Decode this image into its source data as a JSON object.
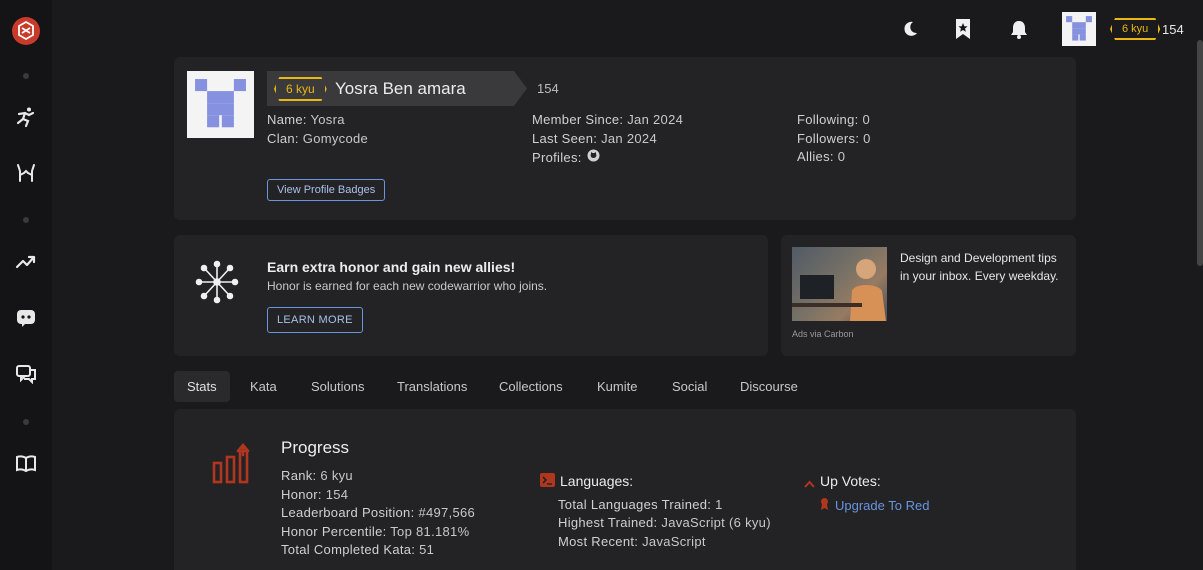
{
  "topbar": {
    "rank": "6 kyu",
    "honor": "154"
  },
  "profile": {
    "rank": "6 kyu",
    "username": "Yosra Ben amara",
    "honor": "154",
    "name_label": "Name:",
    "name": "Yosra",
    "clan_label": "Clan:",
    "clan": "Gomycode",
    "member_since_label": "Member Since:",
    "member_since": "Jan 2024",
    "last_seen_label": "Last Seen:",
    "last_seen": "Jan 2024",
    "profiles_label": "Profiles:",
    "following_label": "Following:",
    "following": "0",
    "followers_label": "Followers:",
    "followers": "0",
    "allies_label": "Allies:",
    "allies": "0",
    "badges_button": "View Profile Badges"
  },
  "promo": {
    "title": "Earn extra honor and gain new allies!",
    "text": "Honor is earned for each new codewarrior who joins.",
    "button": "LEARN MORE"
  },
  "ad": {
    "text": "Design and Development tips in your inbox. Every weekday.",
    "via": "Ads via Carbon"
  },
  "tabs": [
    "Stats",
    "Kata",
    "Solutions",
    "Translations",
    "Collections",
    "Kumite",
    "Social",
    "Discourse"
  ],
  "stats": {
    "progress_title": "Progress",
    "rank_label": "Rank:",
    "rank": "6 kyu",
    "honor_label": "Honor:",
    "honor": "154",
    "leaderboard_label": "Leaderboard Position:",
    "leaderboard": "#497,566",
    "percentile_label": "Honor Percentile:",
    "percentile": "Top 81.181%",
    "completed_label": "Total Completed Kata:",
    "completed": "51",
    "languages_title": "Languages:",
    "total_lang_label": "Total Languages Trained:",
    "total_lang": "1",
    "highest_label": "Highest Trained:",
    "highest": "JavaScript (6 kyu)",
    "recent_label": "Most Recent:",
    "recent": "JavaScript",
    "upvotes_title": "Up Votes:",
    "upgrade": "Upgrade To Red"
  },
  "colors": {
    "accent": "#b1361e",
    "rank": "#ecb613",
    "link": "#6795de"
  }
}
